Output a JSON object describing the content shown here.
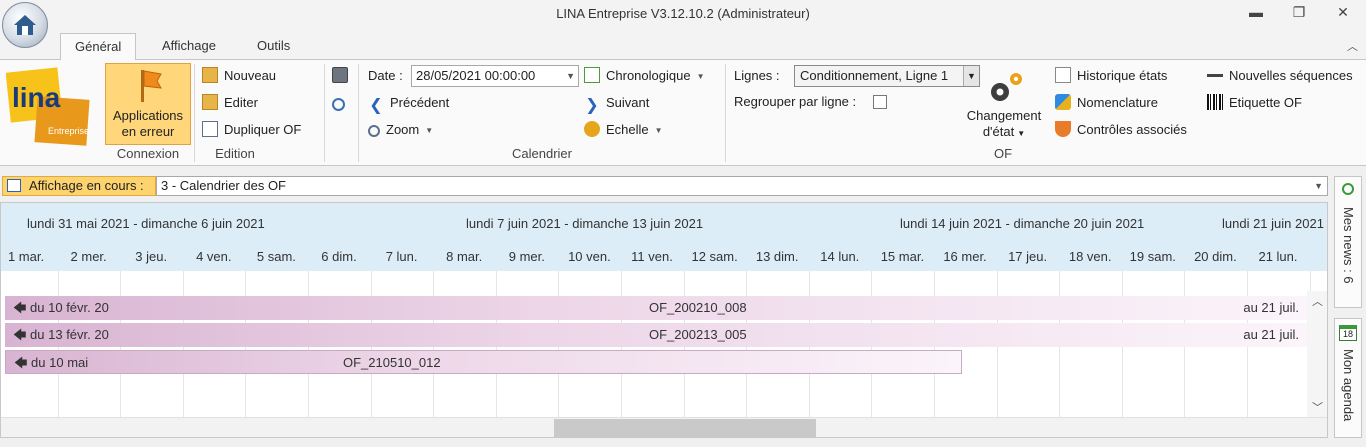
{
  "window": {
    "title": "LINA Entreprise  V3.12.10.2  (Administrateur)",
    "controls": {
      "minimize": "▬",
      "restore": "❐",
      "close": "✕"
    }
  },
  "tabs": [
    {
      "label": "Général",
      "active": true
    },
    {
      "label": "Affichage",
      "active": false
    },
    {
      "label": "Outils",
      "active": false
    }
  ],
  "ribbon": {
    "logo_text": "lina",
    "logo_sub": "Entreprise",
    "connexion": {
      "button_line1": "Applications",
      "button_line2": "en erreur",
      "group": "Connexion"
    },
    "edition": {
      "items": [
        "Nouveau",
        "Editer",
        "Dupliquer OF"
      ],
      "group": "Edition"
    },
    "calendrier": {
      "date_label": "Date :",
      "date_value": "28/05/2021 00:00:00",
      "previous": "Précédent",
      "zoom": "Zoom",
      "chronologique": "Chronologique",
      "next": "Suivant",
      "echelle": "Echelle",
      "group": "Calendrier"
    },
    "of": {
      "lignes_label": "Lignes :",
      "lignes_value": "Conditionnement,  Ligne 1",
      "regrouper_label": "Regrouper par ligne :",
      "regrouper_checked": false,
      "changement_line1": "Changement",
      "changement_line2": "d'état",
      "historique": "Historique états",
      "nomenclature": "Nomenclature",
      "controles": "Contrôles associés",
      "nouvelles": "Nouvelles séquences",
      "etiquette": "Etiquette OF",
      "group": "OF"
    }
  },
  "view": {
    "label": "Affichage en cours :",
    "value": "3 - Calendrier des OF"
  },
  "calendar": {
    "weeks": [
      "lundi 31 mai 2021 - dimanche 6 juin 2021",
      "lundi 7 juin 2021 - dimanche 13 juin 2021",
      "lundi 14 juin 2021 - dimanche 20 juin 2021",
      "lundi 21 juin 2021"
    ],
    "days": [
      "1 mar.",
      "2 mer.",
      "3 jeu.",
      "4 ven.",
      "5 sam.",
      "6 dim.",
      "7 lun.",
      "8 mar.",
      "9 mer.",
      "10 ven.",
      "11 ven.",
      "12 sam.",
      "13 dim.",
      "14 lun.",
      "15 mar.",
      "16 mer.",
      "17 jeu.",
      "18 ven.",
      "19 sam.",
      "20 dim.",
      "21 lun."
    ],
    "orders": [
      {
        "from": "du 10 févr. 20",
        "name": "OF_200210_008",
        "to": "au 21 juil."
      },
      {
        "from": "du 13 févr. 20",
        "name": "OF_200213_005",
        "to": "au 21 juil."
      },
      {
        "from": "du 10 mai",
        "name": "OF_210510_012",
        "to": ""
      }
    ]
  },
  "side_panel": {
    "news": "Mes news : 6",
    "agenda_icon": "18",
    "agenda": "Mon agenda"
  },
  "colors": {
    "accent": "#fdd36e",
    "header_bg": "#dcedf7",
    "bar": "#e4c6de"
  }
}
